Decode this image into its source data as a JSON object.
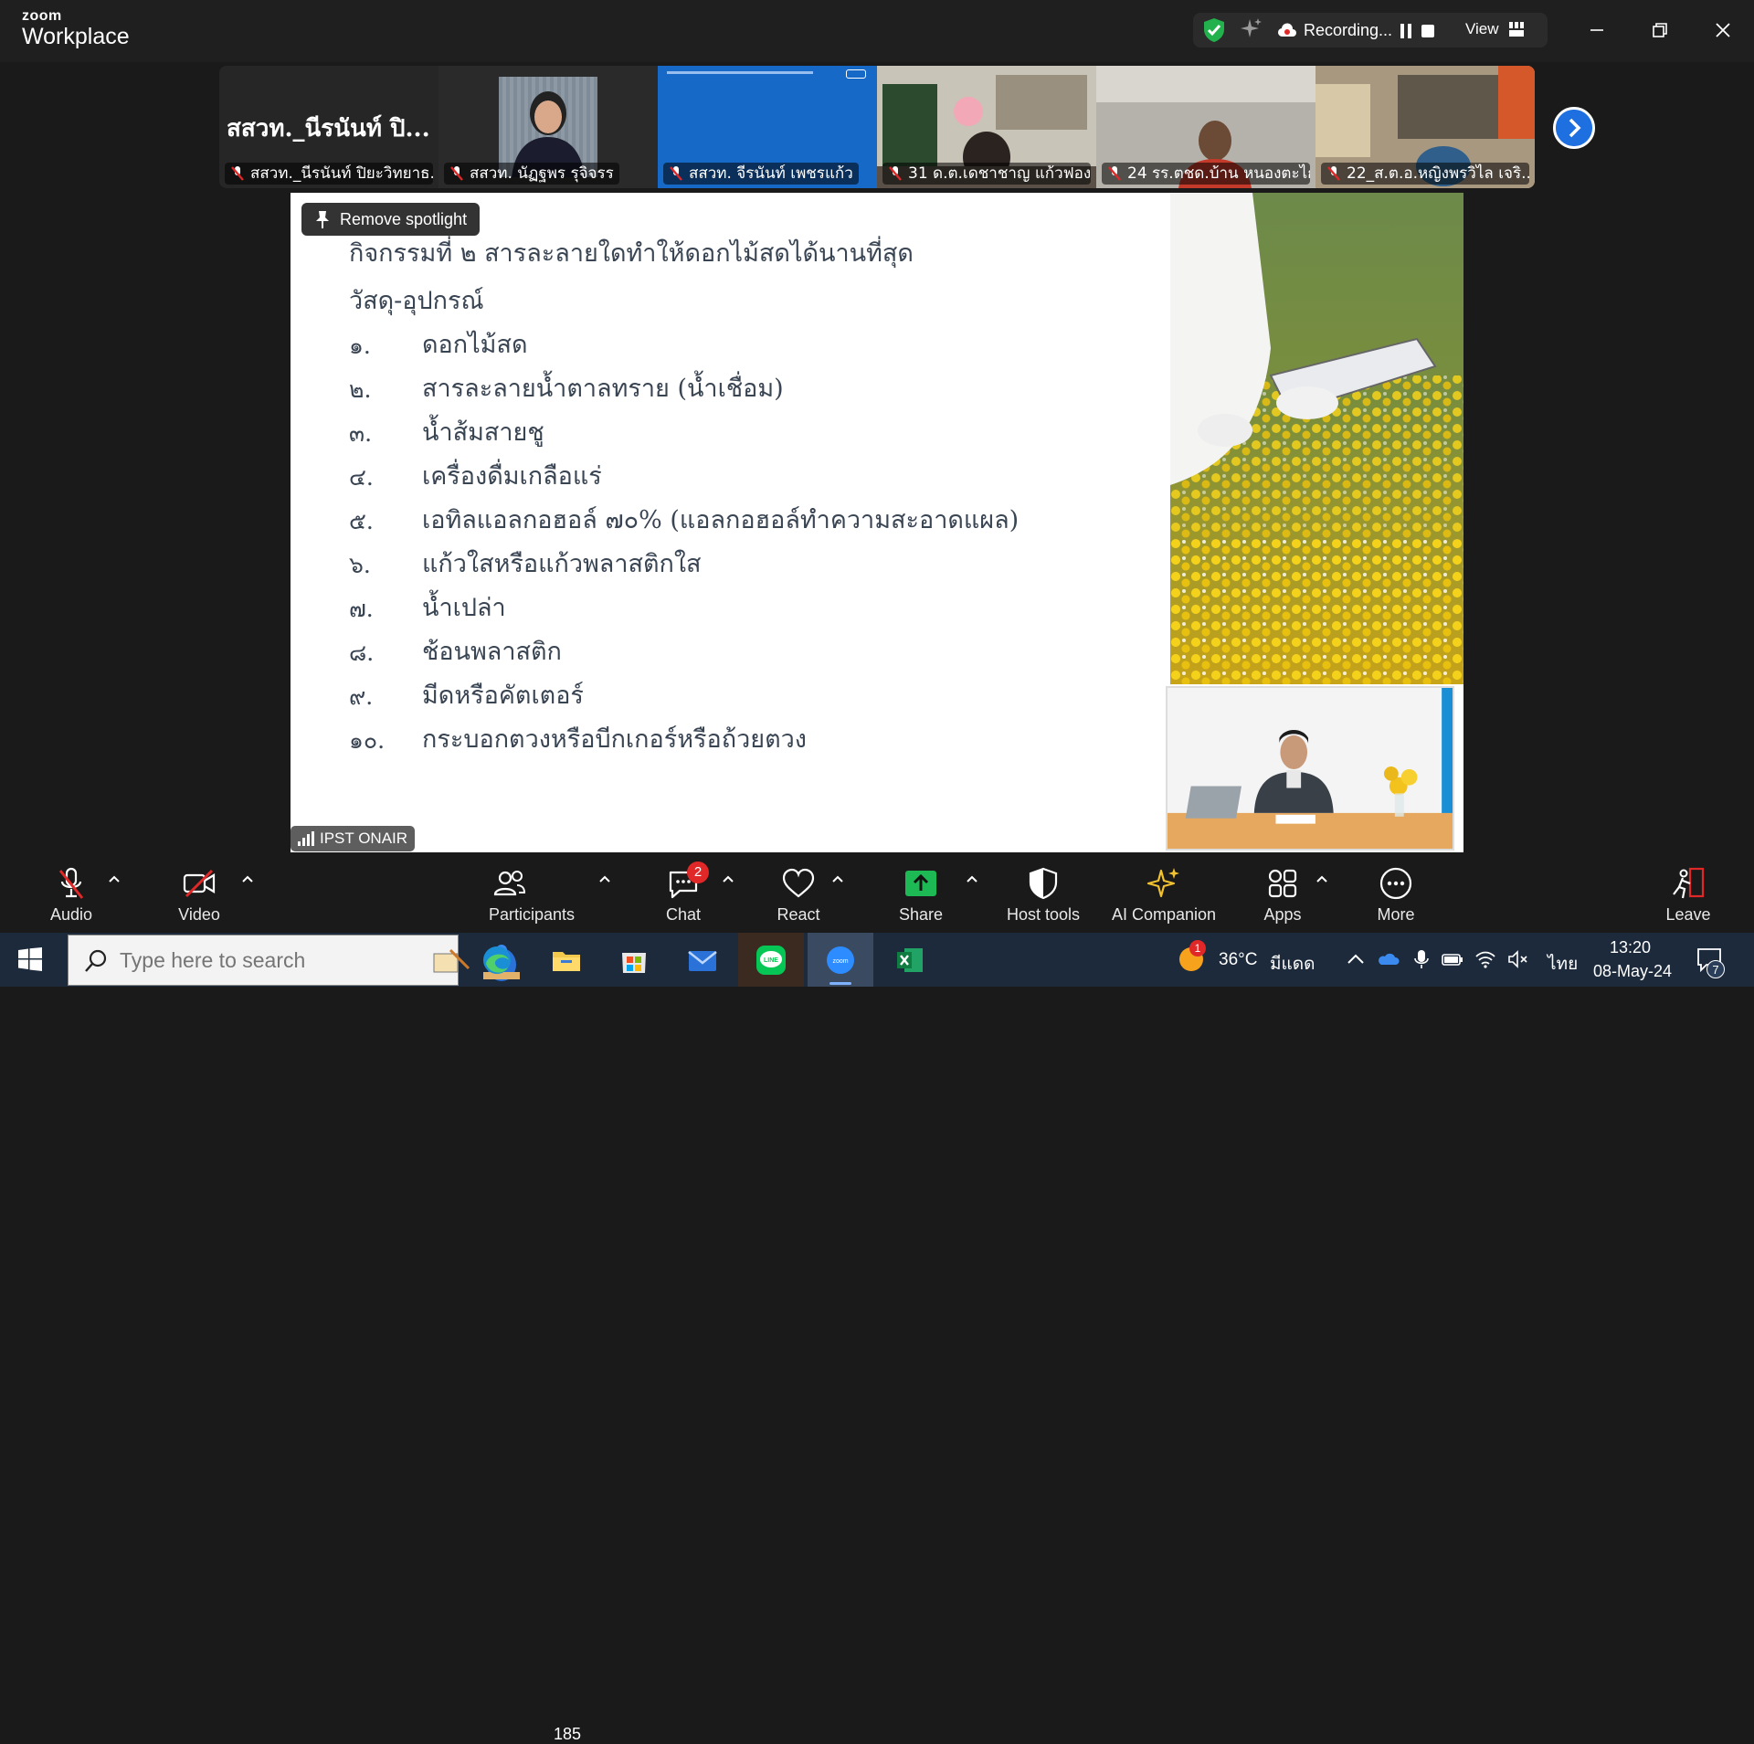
{
  "window": {
    "brand_top": "zoom",
    "brand_bottom": "Workplace",
    "recording_label": "Recording...",
    "view_label": "View"
  },
  "gallery": {
    "tiles": [
      {
        "name": "สสวท._นีรนันท์ ปิยะวิทยาธ...",
        "big_name": "สสวท._นีรนันท์ ปิ...",
        "video": false
      },
      {
        "name": "สสวท. นัฏฐพร รุจิจรร",
        "video": true
      },
      {
        "name": "สสวท. จีรนันท์ เพชรแก้ว",
        "video": true
      },
      {
        "name": "31 ด.ต.เดชาชาญ   แก้วฟอง",
        "video": true
      },
      {
        "name": "24 รร.ตชด.บ้าน หนองตะไก้",
        "video": true
      },
      {
        "name": "22_ส.ต.อ.หญิงพรวิไล  เจริ...",
        "video": true
      }
    ]
  },
  "stage": {
    "spotlight_label": "Remove spotlight",
    "onair_label": "IPST ONAIR",
    "slide": {
      "title": "กิจกรรมที่ ๒  สารละลายใดทำให้ดอกไม้สดได้นานที่สุด",
      "subtitle": "วัสดุ-อุปกรณ์",
      "items": [
        {
          "num": "๑.",
          "text": "ดอกไม้สด"
        },
        {
          "num": "๒.",
          "text": "สารละลายน้ำตาลทราย (น้ำเชื่อม)"
        },
        {
          "num": "๓.",
          "text": "น้ำส้มสายชู"
        },
        {
          "num": "๔.",
          "text": "เครื่องดื่มเกลือแร่"
        },
        {
          "num": "๕.",
          "text": "เอทิลแอลกอฮอล์  ๗๐% (แอลกอฮอล์ทำความสะอาดแผล)"
        },
        {
          "num": "๖.",
          "text": "แก้วใสหรือแก้วพลาสติกใส"
        },
        {
          "num": "๗.",
          "text": "น้ำเปล่า"
        },
        {
          "num": "๘.",
          "text": "ช้อนพลาสติก"
        },
        {
          "num": "๙.",
          "text": "มีดหรือคัตเตอร์"
        },
        {
          "num": "๑๐.",
          "text": "กระบอกตวงหรือบีกเกอร์หรือถ้วยตวง"
        }
      ]
    }
  },
  "toolbar": {
    "audio": "Audio",
    "video": "Video",
    "participants": "Participants",
    "participants_count": "185",
    "chat": "Chat",
    "chat_badge": "2",
    "react": "React",
    "share": "Share",
    "host_tools": "Host tools",
    "ai_companion": "AI Companion",
    "apps": "Apps",
    "more": "More",
    "leave": "Leave"
  },
  "taskbar": {
    "search_placeholder": "Type here to search",
    "weather_temp": "36°C",
    "weather_desc": "มีแดด",
    "weather_badge": "1",
    "language": "ไทย",
    "time": "13:20",
    "date": "08-May-24",
    "notifications": "7"
  },
  "colors": {
    "accent_blue": "#1e6fe0",
    "share_green": "#1db954",
    "muted_red": "#e02828",
    "slide_text": "#3a4554"
  }
}
